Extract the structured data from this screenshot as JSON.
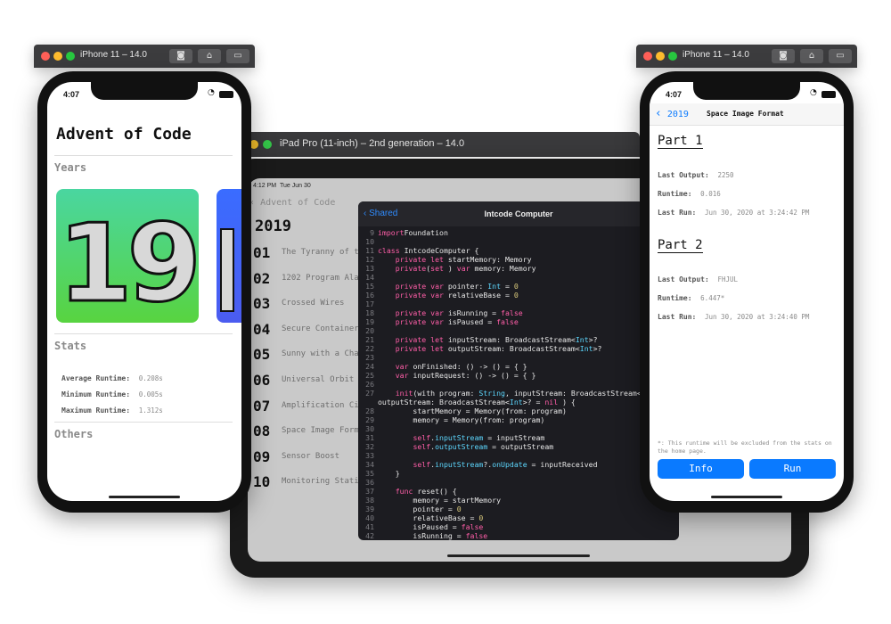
{
  "left_phone": {
    "window_title": "iPhone 11 – 14.0",
    "time": "4:07",
    "title": "Advent of Code",
    "years_header": "Years",
    "year_card_text": "19",
    "stats_header": "Stats",
    "stats": [
      {
        "label": "Average Runtime:",
        "value": "0.208s"
      },
      {
        "label": "Minimum Runtime:",
        "value": "0.005s"
      },
      {
        "label": "Maximum Runtime:",
        "value": "1.312s"
      }
    ],
    "others_header": "Others"
  },
  "ipad": {
    "window_title": "iPad Pro (11-inch) – 2nd generation – 14.0",
    "time": "4:12 PM",
    "date": "Tue Jun 30",
    "back_label": "Advent of Code",
    "year": "2019",
    "days": [
      {
        "num": "01",
        "name": "The Tyranny of th"
      },
      {
        "num": "02",
        "name": "1202 Program Alar"
      },
      {
        "num": "03",
        "name": "Crossed Wires"
      },
      {
        "num": "04",
        "name": "Secure Container"
      },
      {
        "num": "05",
        "name": "Sunny with a Chan"
      },
      {
        "num": "06",
        "name": "Universal Orbit M"
      },
      {
        "num": "07",
        "name": "Amplification Cir"
      },
      {
        "num": "08",
        "name": "Space Image Forma"
      },
      {
        "num": "09",
        "name": "Sensor Boost"
      },
      {
        "num": "10",
        "name": "Monitoring Statio"
      }
    ],
    "code_back": "Shared",
    "code_title": "Intcode Computer",
    "code_lines": [
      {
        "n": "9",
        "segs": [
          [
            "kw",
            "import"
          ],
          [
            "",
            "Foundation"
          ]
        ]
      },
      {
        "n": "10",
        "segs": []
      },
      {
        "n": "11",
        "segs": [
          [
            "kw",
            "class"
          ],
          [
            "",
            " IntcodeComputer {"
          ]
        ]
      },
      {
        "n": "12",
        "segs": [
          [
            "",
            "    "
          ],
          [
            "kw",
            "private let"
          ],
          [
            "",
            " startMemory: Memory"
          ]
        ]
      },
      {
        "n": "13",
        "segs": [
          [
            "",
            "    "
          ],
          [
            "kw",
            "private"
          ],
          [
            "",
            "("
          ],
          [
            "kw",
            "set"
          ],
          [
            "",
            " ) "
          ],
          [
            "kw",
            "var"
          ],
          [
            "",
            " memory: Memory"
          ]
        ]
      },
      {
        "n": "14",
        "segs": []
      },
      {
        "n": "15",
        "segs": [
          [
            "",
            "    "
          ],
          [
            "kw",
            "private var"
          ],
          [
            "",
            " pointer: "
          ],
          [
            "ty",
            "Int"
          ],
          [
            "",
            " = "
          ],
          [
            "nu",
            "0"
          ]
        ]
      },
      {
        "n": "16",
        "segs": [
          [
            "",
            "    "
          ],
          [
            "kw",
            "private var"
          ],
          [
            "",
            " relativeBase = "
          ],
          [
            "nu",
            "0"
          ]
        ]
      },
      {
        "n": "17",
        "segs": []
      },
      {
        "n": "18",
        "segs": [
          [
            "",
            "    "
          ],
          [
            "kw",
            "private var"
          ],
          [
            "",
            " isRunning = "
          ],
          [
            "kw",
            "false"
          ]
        ]
      },
      {
        "n": "19",
        "segs": [
          [
            "",
            "    "
          ],
          [
            "kw",
            "private var"
          ],
          [
            "",
            " isPaused = "
          ],
          [
            "kw",
            "false"
          ]
        ]
      },
      {
        "n": "20",
        "segs": []
      },
      {
        "n": "21",
        "segs": [
          [
            "",
            "    "
          ],
          [
            "kw",
            "private let"
          ],
          [
            "",
            " inputStream: BroadcastStream<"
          ],
          [
            "ty",
            "Int"
          ],
          [
            "",
            ">?"
          ]
        ]
      },
      {
        "n": "22",
        "segs": [
          [
            "",
            "    "
          ],
          [
            "kw",
            "private let"
          ],
          [
            "",
            " outputStream: BroadcastStream<"
          ],
          [
            "ty",
            "Int"
          ],
          [
            "",
            ">?"
          ]
        ]
      },
      {
        "n": "23",
        "segs": []
      },
      {
        "n": "24",
        "segs": [
          [
            "",
            "    "
          ],
          [
            "kw",
            "var"
          ],
          [
            "",
            " onFinished: () -> () = { }"
          ]
        ]
      },
      {
        "n": "25",
        "segs": [
          [
            "",
            "    "
          ],
          [
            "kw",
            "var"
          ],
          [
            "",
            " inputRequest: () -> () = { }"
          ]
        ]
      },
      {
        "n": "26",
        "segs": []
      },
      {
        "n": "27",
        "segs": [
          [
            "",
            "    "
          ],
          [
            "kw",
            "init"
          ],
          [
            "",
            "(with program: "
          ],
          [
            "ty",
            "String"
          ],
          [
            "",
            ", inputStream: BroadcastStream<"
          ],
          [
            "ty",
            "Int"
          ],
          [
            "",
            ">"
          ]
        ]
      },
      {
        "n": "",
        "segs": [
          [
            "",
            "outputStream: BroadcastStream<"
          ],
          [
            "ty",
            "Int"
          ],
          [
            "",
            ">? = "
          ],
          [
            "kw",
            "nil"
          ],
          [
            "",
            " ) {"
          ]
        ]
      },
      {
        "n": "28",
        "segs": [
          [
            "",
            "        startMemory = Memory(from: program)"
          ]
        ]
      },
      {
        "n": "29",
        "segs": [
          [
            "",
            "        memory = Memory(from: program)"
          ]
        ]
      },
      {
        "n": "30",
        "segs": []
      },
      {
        "n": "31",
        "segs": [
          [
            "",
            "        "
          ],
          [
            "kw",
            "self"
          ],
          [
            "",
            "."
          ],
          [
            "ty",
            "inputStream"
          ],
          [
            "",
            " = inputStream"
          ]
        ]
      },
      {
        "n": "32",
        "segs": [
          [
            "",
            "        "
          ],
          [
            "kw",
            "self"
          ],
          [
            "",
            "."
          ],
          [
            "ty",
            "outputStream"
          ],
          [
            "",
            " = outputStream"
          ]
        ]
      },
      {
        "n": "33",
        "segs": []
      },
      {
        "n": "34",
        "segs": [
          [
            "",
            "        "
          ],
          [
            "kw",
            "self"
          ],
          [
            "",
            "."
          ],
          [
            "ty",
            "inputStream"
          ],
          [
            "",
            "?."
          ],
          [
            "ty",
            "onUpdate"
          ],
          [
            "",
            " = inputReceived"
          ]
        ]
      },
      {
        "n": "35",
        "segs": [
          [
            "",
            "    }"
          ]
        ]
      },
      {
        "n": "36",
        "segs": []
      },
      {
        "n": "37",
        "segs": [
          [
            "",
            "    "
          ],
          [
            "kw",
            "func"
          ],
          [
            "",
            " reset() {"
          ]
        ]
      },
      {
        "n": "38",
        "segs": [
          [
            "",
            "        memory = startMemory"
          ]
        ]
      },
      {
        "n": "39",
        "segs": [
          [
            "",
            "        pointer = "
          ],
          [
            "nu",
            "0"
          ]
        ]
      },
      {
        "n": "40",
        "segs": [
          [
            "",
            "        relativeBase = "
          ],
          [
            "nu",
            "0"
          ]
        ]
      },
      {
        "n": "41",
        "segs": [
          [
            "",
            "        isPaused = "
          ],
          [
            "kw",
            "false"
          ]
        ]
      },
      {
        "n": "42",
        "segs": [
          [
            "",
            "        isRunning = "
          ],
          [
            "kw",
            "false"
          ]
        ]
      }
    ]
  },
  "right_phone": {
    "window_title": "iPhone 11 – 14.0",
    "time": "4:07",
    "back_label": "2019",
    "nav_title": "Space Image Format",
    "part1": {
      "title": "Part 1",
      "last_output_label": "Last Output:",
      "last_output": "2250",
      "runtime_label": "Runtime:",
      "runtime": "0.016",
      "last_run_label": "Last Run:",
      "last_run": "Jun 30, 2020 at 3:24:42 PM"
    },
    "part2": {
      "title": "Part 2",
      "last_output_label": "Last Output:",
      "last_output": "FHJUL",
      "runtime_label": "Runtime:",
      "runtime": "6.447*",
      "last_run_label": "Last Run:",
      "last_run": "Jun 30, 2020 at 3:24:40 PM"
    },
    "footnote": "*: This runtime will be excluded from the stats on the home page.",
    "info_button": "Info",
    "run_button": "Run"
  },
  "colors": {
    "accent": "#0a7aff",
    "card_gradient_start": "#4ad6a0",
    "card_gradient_end": "#58d440",
    "code_keyword": "#ff5ea8",
    "code_type": "#5dd8ff"
  }
}
